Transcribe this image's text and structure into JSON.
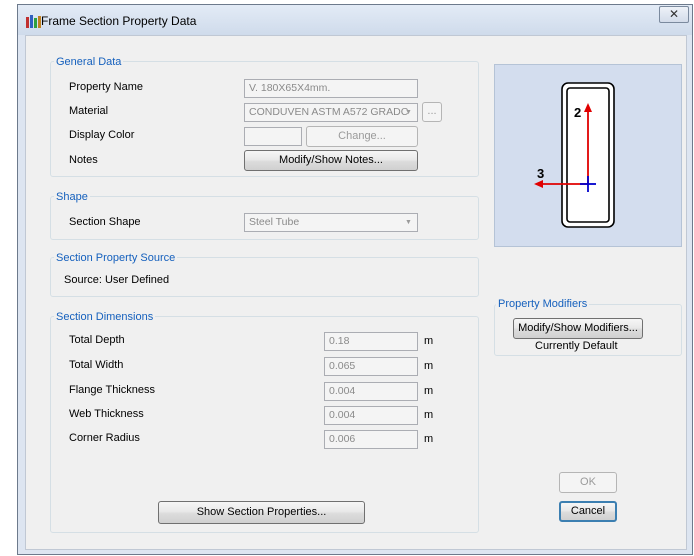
{
  "window": {
    "title": "Frame Section Property Data",
    "close_glyph": "✕"
  },
  "general": {
    "legend": "General Data",
    "property_name_label": "Property Name",
    "property_name_value": "V. 180X65X4mm.",
    "material_label": "Material",
    "material_value": "CONDUVEN ASTM A572 GRADC",
    "material_browse": "...",
    "display_color_label": "Display Color",
    "change_label": "Change...",
    "notes_label": "Notes",
    "notes_button": "Modify/Show Notes..."
  },
  "shape": {
    "legend": "Shape",
    "section_shape_label": "Section Shape",
    "section_shape_value": "Steel Tube"
  },
  "source": {
    "legend": "Section Property Source",
    "text": "Source:  User Defined"
  },
  "dimensions": {
    "legend": "Section Dimensions",
    "rows": [
      {
        "label": "Total Depth",
        "value": "0.18",
        "unit": "m"
      },
      {
        "label": "Total Width",
        "value": "0.065",
        "unit": "m"
      },
      {
        "label": "Flange Thickness",
        "value": "0.004",
        "unit": "m"
      },
      {
        "label": "Web Thickness",
        "value": "0.004",
        "unit": "m"
      },
      {
        "label": "Corner Radius",
        "value": "0.006",
        "unit": "m"
      }
    ],
    "show_properties_button": "Show Section Properties..."
  },
  "preview": {
    "axis2_label": "2",
    "axis3_label": "3"
  },
  "modifiers": {
    "legend": "Property Modifiers",
    "button": "Modify/Show Modifiers...",
    "status": "Currently Default"
  },
  "footer": {
    "ok_label": "OK",
    "cancel_label": "Cancel"
  },
  "colors": {
    "legend_blue": "#1560bd",
    "preview_bg": "#d3ddee",
    "axis_red": "#e00000",
    "axis_blue": "#0000cc"
  }
}
